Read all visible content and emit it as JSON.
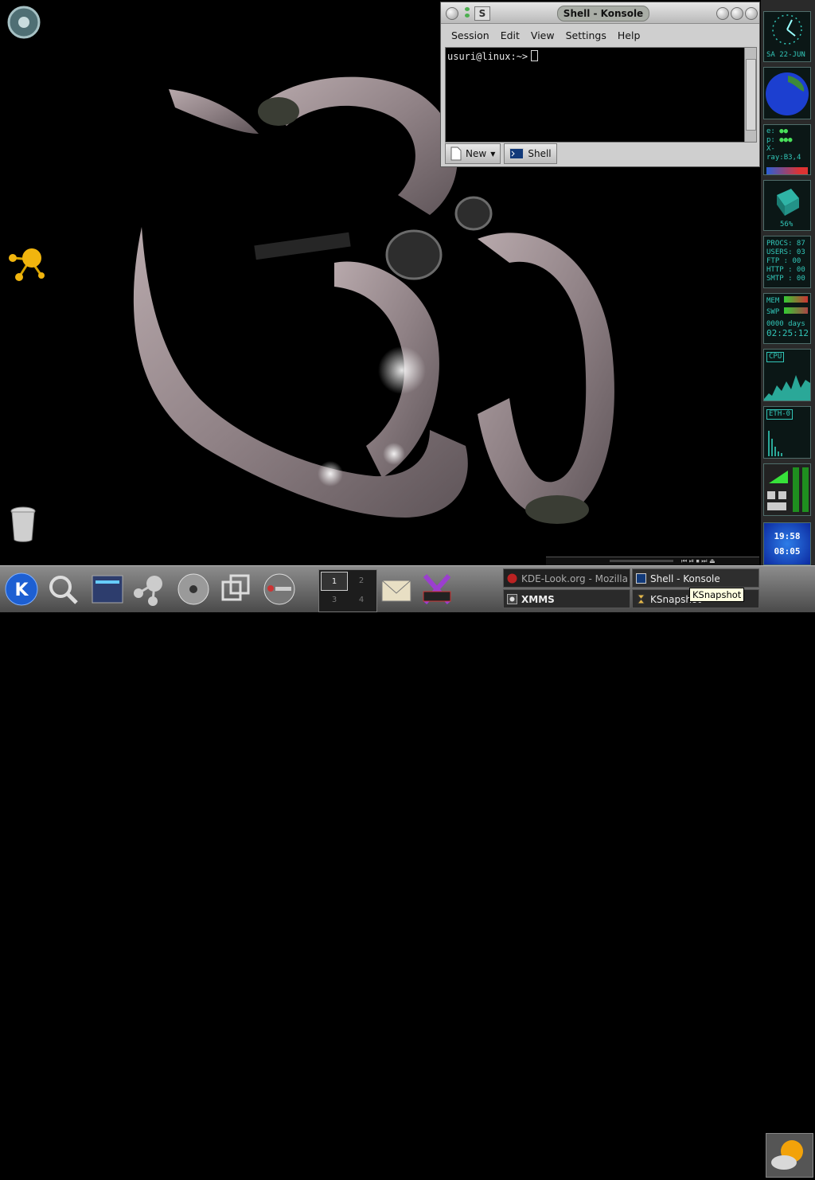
{
  "konsole": {
    "title": "Shell - Konsole",
    "menu": [
      "Session",
      "Edit",
      "View",
      "Settings",
      "Help"
    ],
    "prompt": "usuri@linux:~>",
    "tabs": {
      "new_label": "New",
      "shell_label": "Shell"
    }
  },
  "dock": {
    "clock_date": {
      "day": "SA",
      "date": "22-JUN"
    },
    "mail": {
      "line1": "e:",
      "line2": "p:",
      "line3": "X-ray:",
      "xray_value": "B3,4"
    },
    "cube_percent": "56%",
    "procs": [
      "PROCS: 87",
      "USERS: 03",
      "FTP   : 00",
      "HTTP  : 00",
      "SMTP  : 00"
    ],
    "mem": {
      "mem_label": "MEM",
      "swp_label": "SWP",
      "uptime_label": "0000 days",
      "uptime_value": "02:25:12"
    },
    "cpu_label": "CPU",
    "eth_label": "ETH-0",
    "time": {
      "t1": "19:58",
      "t2": "08:05"
    }
  },
  "pager": {
    "desktops": [
      "1",
      "2",
      "3",
      "4"
    ],
    "active": "1"
  },
  "taskbar": {
    "tasks": [
      {
        "label": "KDE-Look.org - Mozilla"
      },
      {
        "label": "Shell - Konsole"
      },
      {
        "label": "XMMS"
      },
      {
        "label": "KSnapshot"
      }
    ]
  },
  "tooltip": "KSnapshot",
  "colors": {
    "lcd": "#32c6b8",
    "desktop": "#000000",
    "panel": "#6a6a6a"
  }
}
